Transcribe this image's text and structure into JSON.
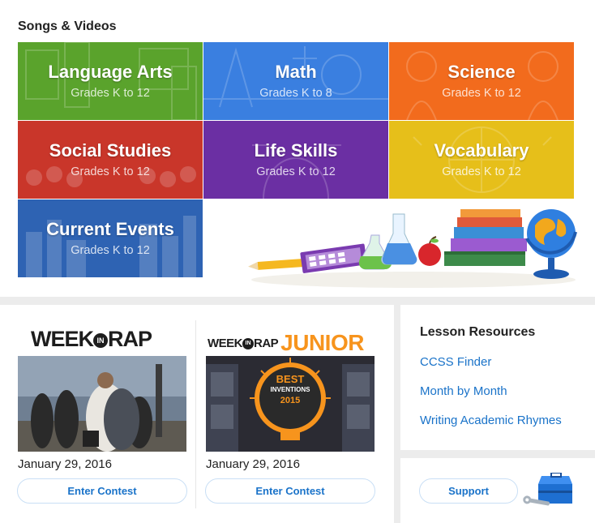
{
  "songs_videos": {
    "title": "Songs & Videos",
    "tiles": [
      {
        "title": "Language Arts",
        "grades": "Grades K to 12",
        "color": "#5aa32c"
      },
      {
        "title": "Math",
        "grades": "Grades K to 8",
        "color": "#3a7fe0"
      },
      {
        "title": "Science",
        "grades": "Grades K to 12",
        "color": "#f26b1d"
      },
      {
        "title": "Social Studies",
        "grades": "Grades K to 12",
        "color": "#c9362a"
      },
      {
        "title": "Life Skills",
        "grades": "Grades K to 12",
        "color": "#6b2fa3"
      },
      {
        "title": "Vocabulary",
        "grades": "Grades K to 12",
        "color": "#e6bf1a"
      },
      {
        "title": "Current Events",
        "grades": "Grades K to 12",
        "color": "#2e63b3"
      }
    ]
  },
  "week_in_rap": {
    "logo_left": "WEEK",
    "logo_in": "IN",
    "logo_right": "RAP",
    "date": "January 29, 2016",
    "button": "Enter Contest"
  },
  "week_in_rap_junior": {
    "logo_left": "WEEK",
    "logo_in": "IN",
    "logo_right": "RAP",
    "logo_junior": "JUNIOR",
    "badge_best": "BEST",
    "badge_word": "INVENTIONS",
    "badge_year": "2015",
    "date": "January 29, 2016",
    "button": "Enter Contest"
  },
  "lesson_resources": {
    "title": "Lesson Resources",
    "links": [
      "CCSS Finder",
      "Month by Month",
      "Writing Academic Rhymes"
    ]
  },
  "support": {
    "button": "Support",
    "icon": "toolbox-icon"
  },
  "colors": {
    "link": "#1a73c9",
    "junior_orange": "#f7941d"
  }
}
